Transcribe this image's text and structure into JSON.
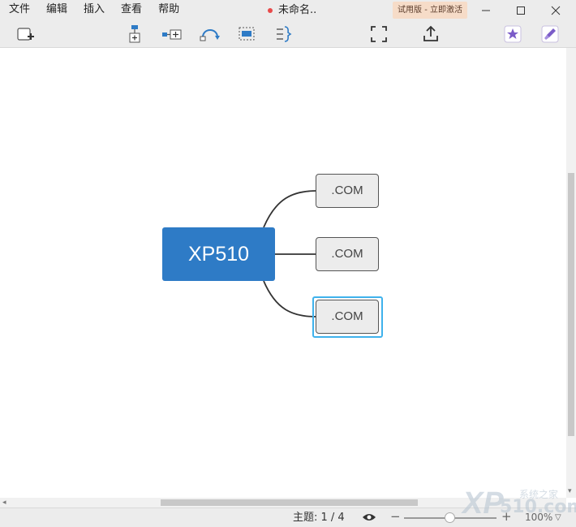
{
  "menu": [
    "文件",
    "编辑",
    "插入",
    "查看",
    "帮助"
  ],
  "document": {
    "title": "未命名.."
  },
  "trial_badge": "试用版 - 立即激活",
  "toolbar": {
    "icons": [
      "new-topic-icon",
      "subtopic-icon",
      "floating-topic-icon",
      "relationship-icon",
      "boundary-icon",
      "summary-icon",
      "fullscreen-icon",
      "export-icon",
      "upgrade-icon",
      "theme-icon"
    ]
  },
  "map": {
    "central_topic": "XP510",
    "subtopics": [
      ".COM",
      ".COM",
      ".COM"
    ],
    "selected_index": 2,
    "accent_color": "#2e7bc6",
    "selection_color": "#3fb2ec"
  },
  "status": {
    "topic_count": "主题: 1 / 4",
    "zoom_minus": "−",
    "zoom_plus": "+",
    "zoom_level": "100%"
  },
  "watermark": {
    "logo": "XP",
    "line1": "系统之家",
    "line2": "510.com"
  }
}
